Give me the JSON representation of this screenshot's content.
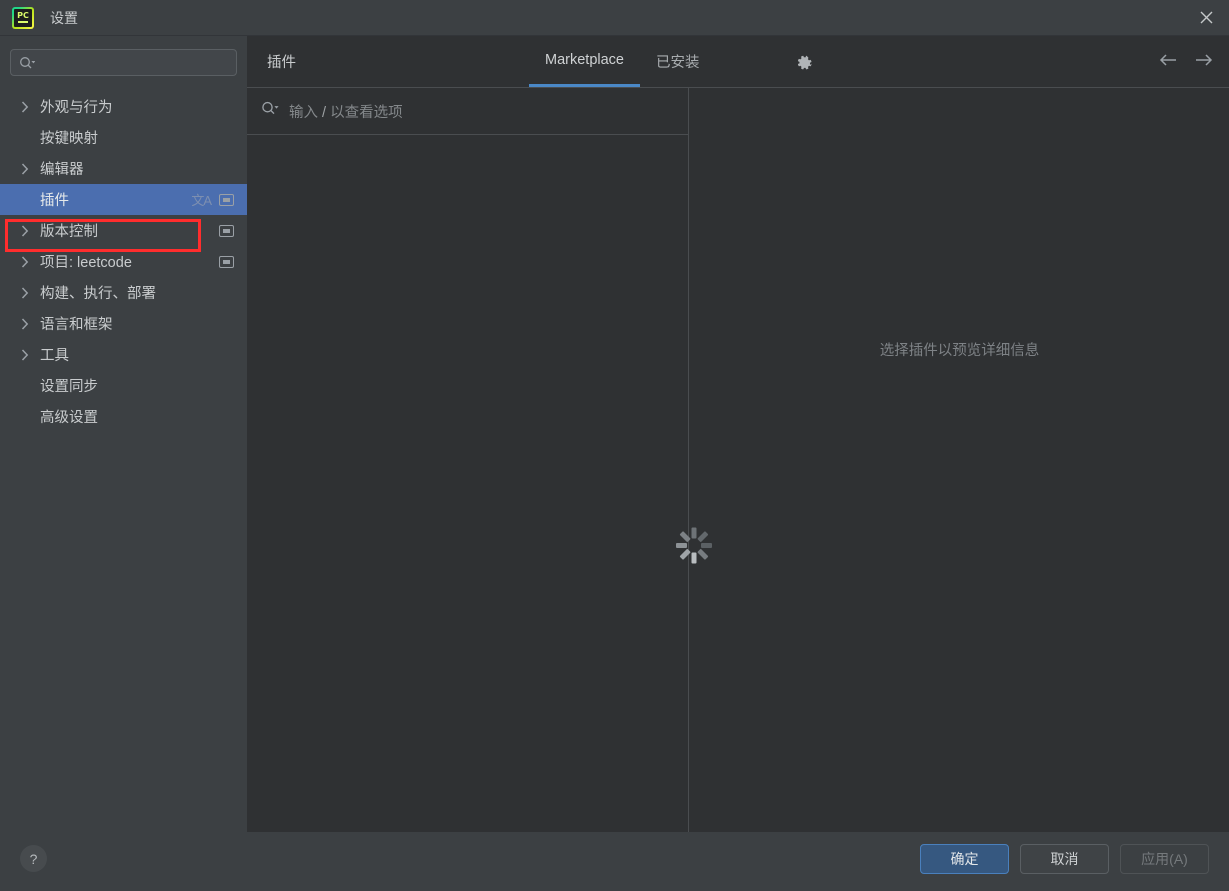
{
  "window": {
    "title": "设置",
    "logo_icon": "pycharm-logo-icon",
    "logo_text": "PC",
    "close_icon": "close-icon"
  },
  "sidebar": {
    "search": {
      "icon": "search-icon",
      "value": "",
      "placeholder": ""
    },
    "items": [
      {
        "label": "外观与行为",
        "expandable": true,
        "badge": null,
        "translate_badge": false,
        "selected": false
      },
      {
        "label": "按键映射",
        "expandable": false,
        "badge": null,
        "translate_badge": false,
        "selected": false
      },
      {
        "label": "编辑器",
        "expandable": true,
        "badge": null,
        "translate_badge": false,
        "selected": false
      },
      {
        "label": "插件",
        "expandable": false,
        "badge": "screen-icon",
        "translate_badge": true,
        "selected": true
      },
      {
        "label": "版本控制",
        "expandable": true,
        "badge": "screen-icon",
        "translate_badge": false,
        "selected": false
      },
      {
        "label": "项目: leetcode",
        "expandable": true,
        "badge": "screen-icon",
        "translate_badge": false,
        "selected": false
      },
      {
        "label": "构建、执行、部署",
        "expandable": true,
        "badge": null,
        "translate_badge": false,
        "selected": false
      },
      {
        "label": "语言和框架",
        "expandable": true,
        "badge": null,
        "translate_badge": false,
        "selected": false
      },
      {
        "label": "工具",
        "expandable": true,
        "badge": null,
        "translate_badge": false,
        "selected": false
      },
      {
        "label": "设置同步",
        "expandable": false,
        "badge": null,
        "translate_badge": false,
        "selected": false
      },
      {
        "label": "高级设置",
        "expandable": false,
        "badge": null,
        "translate_badge": false,
        "selected": false
      }
    ],
    "translate_badge_text": "文A"
  },
  "annotation": {
    "color": "#ff2d2d",
    "target": "插件"
  },
  "main": {
    "header_title": "插件",
    "tabs": [
      {
        "label": "Marketplace",
        "active": true
      },
      {
        "label": "已安装",
        "active": false
      }
    ],
    "gear_icon": "gear-icon",
    "nav_back_icon": "arrow-left-icon",
    "nav_forward_icon": "arrow-forward-icon",
    "marketplace_search": {
      "icon": "search-icon",
      "placeholder_prefix": "输入",
      "placeholder_slash": "/",
      "placeholder_suffix": "以查看选项",
      "value": ""
    },
    "loading": {
      "icon": "loading-spinner-icon",
      "visible": true
    },
    "detail_empty_text": "选择插件以预览详细信息"
  },
  "footer": {
    "help_label": "?",
    "buttons": [
      {
        "label": "确定",
        "style": "primary"
      },
      {
        "label": "取消",
        "style": "normal"
      },
      {
        "label": "应用(A)",
        "style": "disabled"
      }
    ]
  },
  "colors": {
    "accent_blue": "#4b6eaf",
    "tab_underline": "#4a88c7",
    "window_bg": "#3c4043",
    "content_bg": "#2f3133",
    "annotation_red": "#ff2d2d"
  }
}
